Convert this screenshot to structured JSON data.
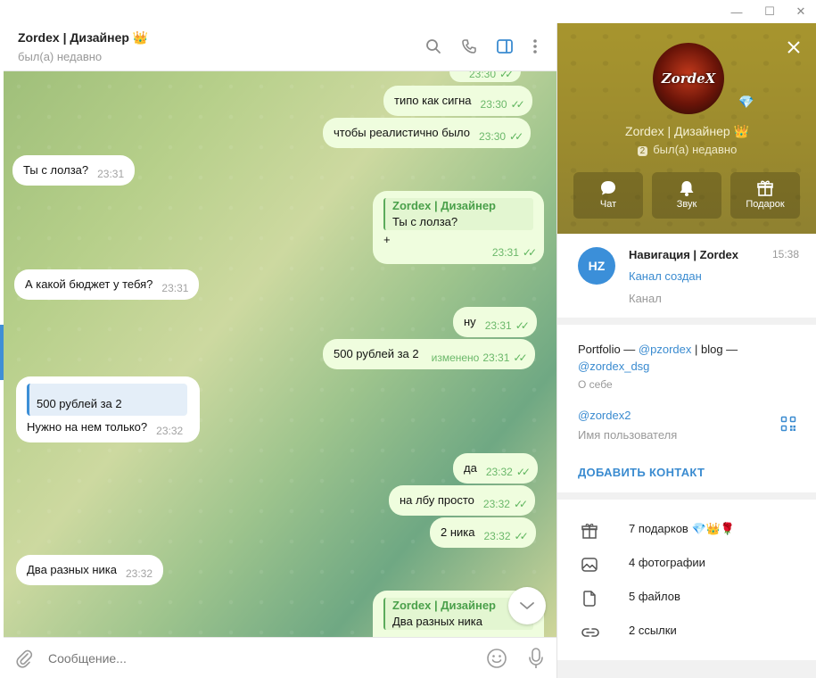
{
  "window": {
    "minimize_glyph": "—",
    "maximize_glyph": "☐",
    "close_glyph": "✕"
  },
  "chat": {
    "title": "Zordex | Дизайнер",
    "title_emoji": "👑",
    "status": "был(а) недавно",
    "composer_placeholder": "Сообщение...",
    "messages": [
      {
        "dir": "out",
        "text": "типо как сигна",
        "time": "23:30"
      },
      {
        "dir": "out",
        "text": "чтобы реалистично было",
        "time": "23:30"
      },
      {
        "dir": "in",
        "text": "Ты с лолза?",
        "time": "23:31"
      },
      {
        "dir": "out",
        "reply_name": "Zordex | Дизайнер",
        "reply_text": "Ты с лолза?",
        "text": "+",
        "time": "23:31"
      },
      {
        "dir": "in",
        "text": "А какой бюджет у тебя?",
        "time": "23:31"
      },
      {
        "dir": "out",
        "text": "ну",
        "time": "23:31"
      },
      {
        "dir": "out",
        "text": "500 рублей за 2",
        "edited": "изменено",
        "time": "23:31"
      },
      {
        "dir": "in",
        "quote": "500 рублей за 2",
        "text": "Нужно на нем только?",
        "time": "23:32"
      },
      {
        "dir": "out",
        "text": "да",
        "time": "23:32"
      },
      {
        "dir": "out",
        "text": "на лбу просто",
        "time": "23:32"
      },
      {
        "dir": "out",
        "text": "2 ника",
        "time": "23:32"
      },
      {
        "dir": "in",
        "text": "Два разных ника",
        "time": "23:32"
      },
      {
        "dir": "out",
        "reply_name": "Zordex | Дизайнер",
        "reply_text": "Два разных ника",
        "text": "",
        "time": ""
      }
    ]
  },
  "profile": {
    "name": "Zordex | Дизайнер",
    "name_emoji": "👑",
    "avatar_text": "ZordeX",
    "sticker_badge": "💎",
    "status_badge": "2",
    "status": "был(а) недавно",
    "actions": [
      {
        "label": "Чат",
        "icon": "chat-bubble-icon"
      },
      {
        "label": "Звук",
        "icon": "bell-icon"
      },
      {
        "label": "Подарок",
        "icon": "gift-icon"
      }
    ],
    "channel": {
      "avatar_initials": "HZ",
      "title": "Навигация | Zordex",
      "time": "15:38",
      "subtitle": "Канал создан",
      "type": "Канал"
    },
    "bio": {
      "prefix": "Portfolio — ",
      "link1": "@pzordex",
      "middle": " | blog — ",
      "link2": "@zordex_dsg"
    },
    "about_label": "О себе",
    "username": "@zordex2",
    "username_label": "Имя пользователя",
    "add_contact": "ДОБАВИТЬ КОНТАКТ",
    "media": [
      {
        "icon": "gift-box-icon",
        "text": "7 подарков 💎👑🌹"
      },
      {
        "icon": "photo-icon",
        "text": "4 фотографии"
      },
      {
        "icon": "file-icon",
        "text": "5 файлов"
      },
      {
        "icon": "link-icon",
        "text": "2 ссылки"
      }
    ]
  }
}
